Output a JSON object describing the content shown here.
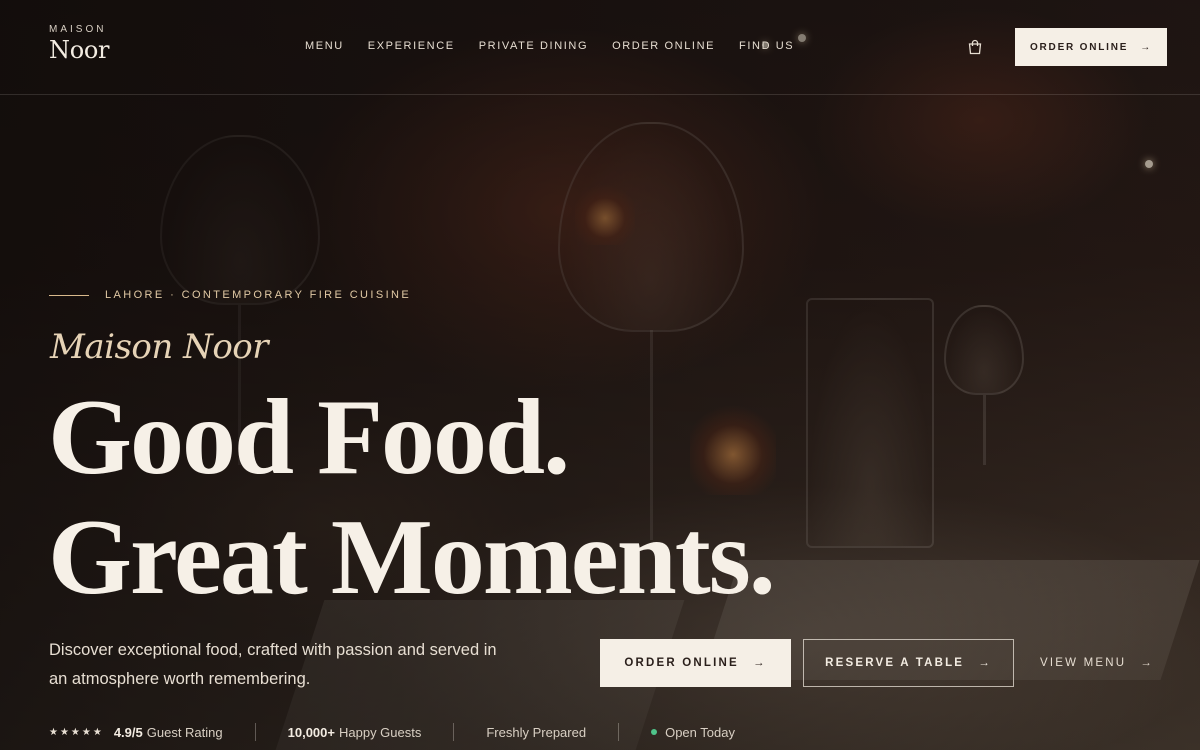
{
  "brand": {
    "small": "MAISON",
    "name": "Noor"
  },
  "nav": {
    "items": [
      "MENU",
      "EXPERIENCE",
      "PRIVATE DINING",
      "ORDER ONLINE",
      "FIND US"
    ]
  },
  "header": {
    "cta_label": "ORDER ONLINE",
    "cta_arrow": "→",
    "cart_icon": "shopping-bag-icon"
  },
  "hero": {
    "eyebrow": "LAHORE · CONTEMPORARY FIRE CUISINE",
    "script_name": "Maison Noor",
    "headline_line1": "Good Food.",
    "headline_line2": "Great Moments.",
    "lead": "Discover exceptional food, crafted with passion and served in an atmosphere worth remembering."
  },
  "actions": {
    "primary": "ORDER ONLINE",
    "secondary": "RESERVE A TABLE",
    "tertiary": "VIEW MENU",
    "arrow": "→"
  },
  "stats": {
    "stars": "★★★★★",
    "rating_value": "4.9/5",
    "rating_label": "Guest Rating",
    "guests_value": "10,000+",
    "guests_label": "Happy Guests",
    "fresh": "Freshly Prepared",
    "open": "Open Today"
  },
  "colors": {
    "accent_gold": "#e1c9a4",
    "cream": "#f5efe6",
    "status_open": "#4fc48a"
  }
}
